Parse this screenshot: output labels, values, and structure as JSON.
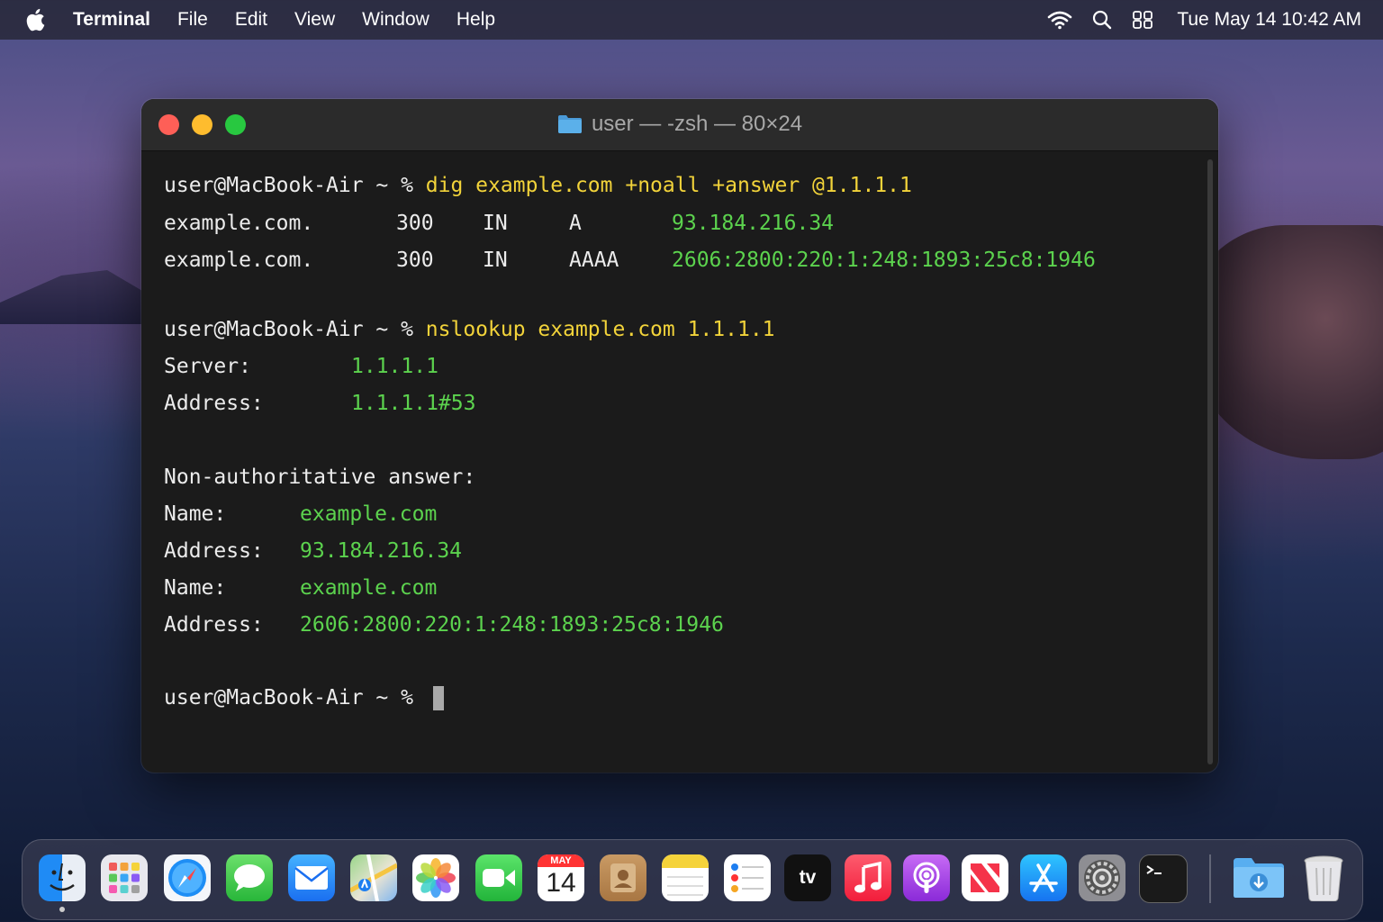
{
  "menubar": {
    "app_name": "Terminal",
    "menus": [
      "File",
      "Edit",
      "View",
      "Window",
      "Help"
    ],
    "clock": "Tue May 14  10:42 AM"
  },
  "window": {
    "title": "user — -zsh — 80×24"
  },
  "terminal": {
    "prompt": "user@MacBook-Air ~ % ",
    "cmd1": "dig example.com +noall +answer @1.1.1.1",
    "dig_rows": [
      {
        "name": "example.com.",
        "ttl": "300",
        "class": "IN",
        "type": "A",
        "value": "93.184.216.34"
      },
      {
        "name": "example.com.",
        "ttl": "300",
        "class": "IN",
        "type": "AAAA",
        "value": "2606:2800:220:1:248:1893:25c8:1946"
      }
    ],
    "cmd2": "nslookup example.com 1.1.1.1",
    "server_label": "Server:",
    "server_value": "1.1.1.1",
    "address_label": "Address:",
    "address_value": "1.1.1.1#53",
    "nonauth": "Non-authoritative answer:",
    "name_label": "Name:",
    "answers": [
      {
        "name": "example.com",
        "address": "93.184.216.34"
      },
      {
        "name": "example.com",
        "address": "2606:2800:220:1:248:1893:25c8:1946"
      }
    ]
  },
  "dock": {
    "apps": [
      "Finder",
      "Launchpad",
      "Safari",
      "Messages",
      "Mail",
      "Maps",
      "Photos",
      "FaceTime",
      "Calendar",
      "Contacts",
      "Notes",
      "Reminders",
      "TV",
      "Music",
      "Podcasts",
      "News",
      "App Store",
      "System Preferences",
      "Terminal"
    ],
    "calendar_month": "MAY",
    "calendar_day": "14",
    "tv_label": "tv"
  },
  "colors": {
    "command": "#f2d33a",
    "output_value": "#5cd34e",
    "terminal_bg": "#1b1b1b"
  }
}
